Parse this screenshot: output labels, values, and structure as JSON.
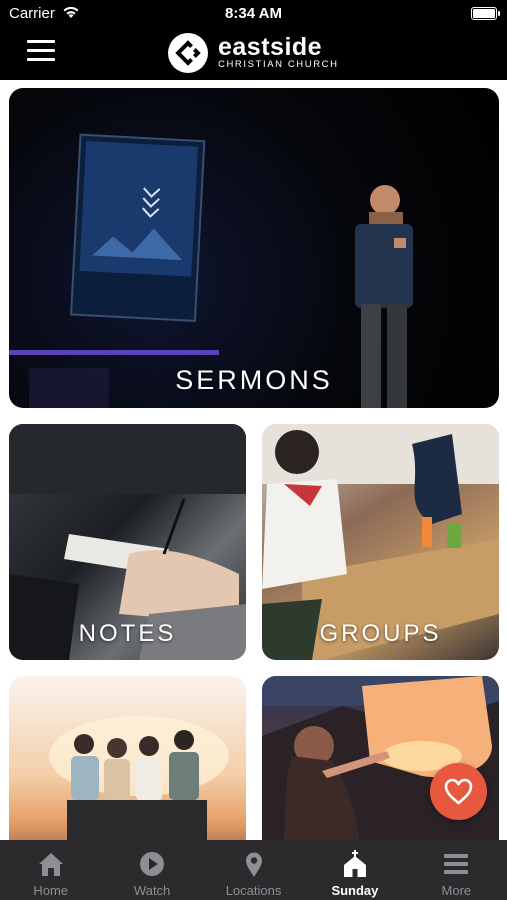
{
  "status_bar": {
    "carrier": "Carrier",
    "time": "8:34 AM"
  },
  "header": {
    "menu_icon": "hamburger-menu-icon",
    "logo_name": "eastside",
    "logo_subtitle": "CHRISTIAN CHURCH"
  },
  "tiles": [
    {
      "label": "SERMONS"
    },
    {
      "label": "NOTES"
    },
    {
      "label": "GROUPS"
    },
    {
      "label": ""
    },
    {
      "label": ""
    }
  ],
  "favorite_button": {
    "icon": "heart-icon",
    "color": "#e8583f"
  },
  "tab_bar": {
    "items": [
      {
        "label": "Home",
        "icon": "home-icon"
      },
      {
        "label": "Watch",
        "icon": "play-icon"
      },
      {
        "label": "Locations",
        "icon": "location-pin-icon"
      },
      {
        "label": "Sunday",
        "icon": "church-icon",
        "active": true
      },
      {
        "label": "More",
        "icon": "more-lines-icon"
      }
    ],
    "active_color": "#ffffff",
    "inactive_color": "#8e8e93"
  }
}
